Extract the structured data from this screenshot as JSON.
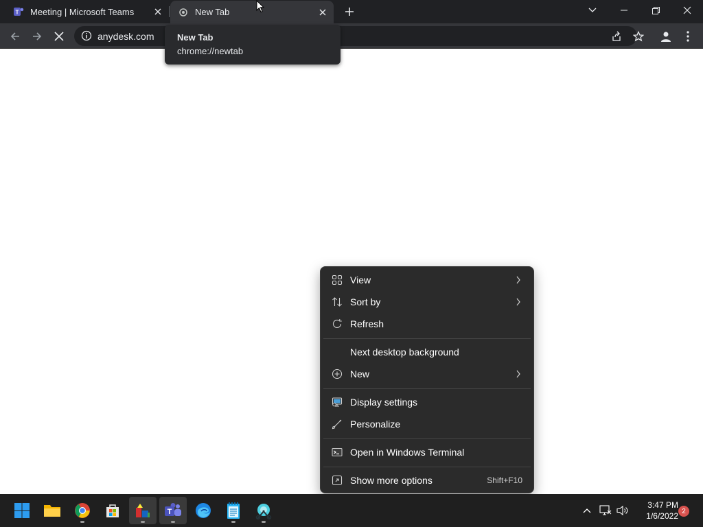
{
  "browser": {
    "tabs": [
      {
        "title": "Meeting | Microsoft Teams",
        "icon": "teams-icon",
        "active": false
      },
      {
        "title": "New Tab",
        "icon": "chrome-icon",
        "active": true
      }
    ],
    "address": "anydesk.com",
    "hover_card": {
      "title": "New Tab",
      "url": "chrome://newtab"
    }
  },
  "context_menu": {
    "items": [
      {
        "label": "View",
        "icon": "grid-icon",
        "submenu": true
      },
      {
        "label": "Sort by",
        "icon": "sort-icon",
        "submenu": true
      },
      {
        "label": "Refresh",
        "icon": "refresh-icon",
        "submenu": false
      },
      {
        "label": "Next desktop background",
        "icon": "",
        "submenu": false
      },
      {
        "label": "New",
        "icon": "new-icon",
        "submenu": true
      },
      {
        "label": "Display settings",
        "icon": "display-icon",
        "submenu": false
      },
      {
        "label": "Personalize",
        "icon": "brush-icon",
        "submenu": false
      },
      {
        "label": "Open in Windows Terminal",
        "icon": "terminal-icon",
        "submenu": false
      },
      {
        "label": "Show more options",
        "icon": "more-options-icon",
        "shortcut": "Shift+F10"
      }
    ]
  },
  "taskbar": {
    "apps": [
      "start",
      "file-explorer",
      "chrome",
      "microsoft-store",
      "app-5",
      "teams",
      "edge",
      "notepad",
      "snip"
    ],
    "time": "3:47 PM",
    "date": "1/6/2022",
    "notification_count": "2"
  }
}
